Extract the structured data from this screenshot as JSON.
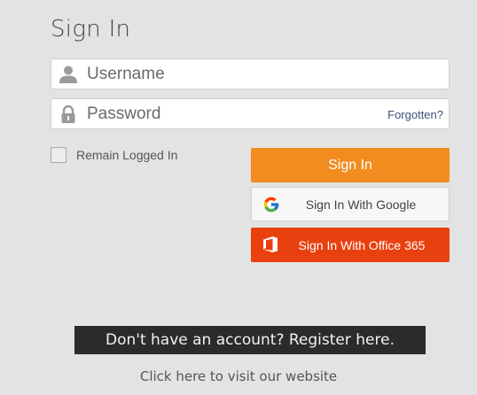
{
  "page": {
    "title": "Sign In"
  },
  "form": {
    "username": {
      "placeholder": "Username",
      "value": ""
    },
    "password": {
      "placeholder": "Password",
      "value": ""
    },
    "forgot_link": "Forgotten?",
    "remember_label": "Remain Logged In",
    "remember_checked": false
  },
  "buttons": {
    "signin": "Sign In",
    "google": "Sign In With Google",
    "office": "Sign In With Office 365"
  },
  "footer": {
    "register": "Don't have an account? Register here.",
    "website": "Click here to visit our website"
  },
  "icons": {
    "username": "user-icon",
    "password": "lock-icon",
    "google": "google-logo-icon",
    "office": "office-365-logo-icon"
  },
  "colors": {
    "background": "#e3e3e3",
    "signin": "#f28c1f",
    "office": "#e9400f",
    "register_bg": "#2b2b2b",
    "link": "#3d4e7a"
  }
}
